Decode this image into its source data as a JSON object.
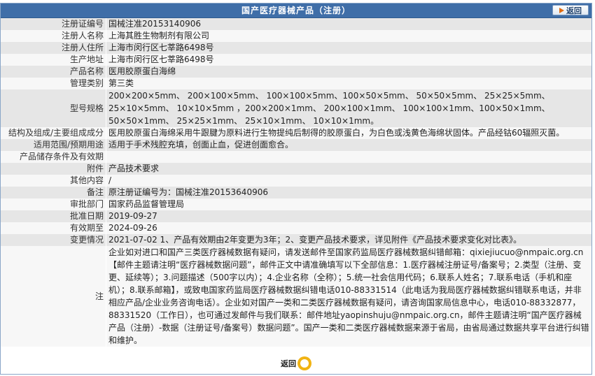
{
  "header": {
    "title": "国产医疗器械产品（注册）",
    "back_label": "返回"
  },
  "rows": [
    {
      "label": "注册证编号",
      "value": "国械注准20153140906"
    },
    {
      "label": "注册人名称",
      "value": "上海其胜生物制剂有限公司"
    },
    {
      "label": "注册人住所",
      "value": "上海市闵行区七莘路6498号"
    },
    {
      "label": "生产地址",
      "value": "上海市闵行区七莘路6498号"
    },
    {
      "label": "产品名称",
      "value": "医用胶原蛋白海绵"
    },
    {
      "label": "管理类别",
      "value": "第三类"
    },
    {
      "label": "型号规格",
      "value": "200×200×5mm、 200×100×5mm、 100×100×5mm、100×50×5mm、 50×50×5mm、 25×25×5mm、 25×10×5mm、 10×10×5mm ，200×200×1mm、 200×100×1mm、 100×100×1mm、100×50×1mm、 50×50×1mm、 25×25×1mm、 25×10×1mm、 10×10×1mm。"
    },
    {
      "label": "结构及组成/主要组成成分",
      "value": "医用胶原蛋白海绵采用牛跟腱为原料进行生物提纯后制得的胶原蛋白，为白色或浅黄色海绵状固体。产品经钴60辐照灭菌。"
    },
    {
      "label": "适用范围/预期用途",
      "value": "适用于手术残腔充填，创面止血，促进创面愈合。"
    },
    {
      "label": "产品储存条件及有效期",
      "value": ""
    },
    {
      "label": "附件",
      "value": "产品技术要求"
    },
    {
      "label": "其他内容",
      "value": "/"
    },
    {
      "label": "备注",
      "value": "原注册证编号为：国械注准20153640906"
    },
    {
      "label": "审批部门",
      "value": "国家药品监督管理局"
    },
    {
      "label": "批准日期",
      "value": "2019-09-27"
    },
    {
      "label": "有效期至",
      "value": "2024-09-26"
    },
    {
      "label": "变更情况",
      "value": "2021-07-02 1、产品有效期由2年变更为3年；2、变更产品技术要求，详见附件《产品技术要求变化对比表》。"
    },
    {
      "label": "注",
      "value": "企业如对进口和国产三类医疗器械数据有疑问，请发送邮件至国家药监局医疗器械数据纠错邮箱：qixiejiucuo@nmpaic.org.cn【邮件主题请注明“医疗器械数据问题”，邮件正文中请准确填写以下全部信息：1.医疗器械注册证号/备案号；2.类型（注册、变更、延续等）；3.问题描述（500字以内）；4.企业名称（全称）；5.统一社会信用代码；6.联系人姓名；7.联系电话（手机和座机）；8.联系邮箱】，或致电国家药监局医疗器械数据纠错电话010-88331514（此电话为我局医疗器械数据纠错联系电话，并非相应产品/企业业务咨询电话）。企业如对国产一类和二类医疗器械数据有疑问，请咨询国家局信息中心，电话010-88332877，88331520（工作日），也可通过发邮件与我们联系：邮件地址yaopinshuju@nmpaic.org.cn，邮件主题请注明“国产医疗器械产品（注册）-数据（注册证号/备案号）数据问题”。国产一类和二类医疗器械数据来源于省局，由省局通过数据共享平台进行纠错和维护。"
    }
  ],
  "footer": {
    "back_label": "返回"
  }
}
